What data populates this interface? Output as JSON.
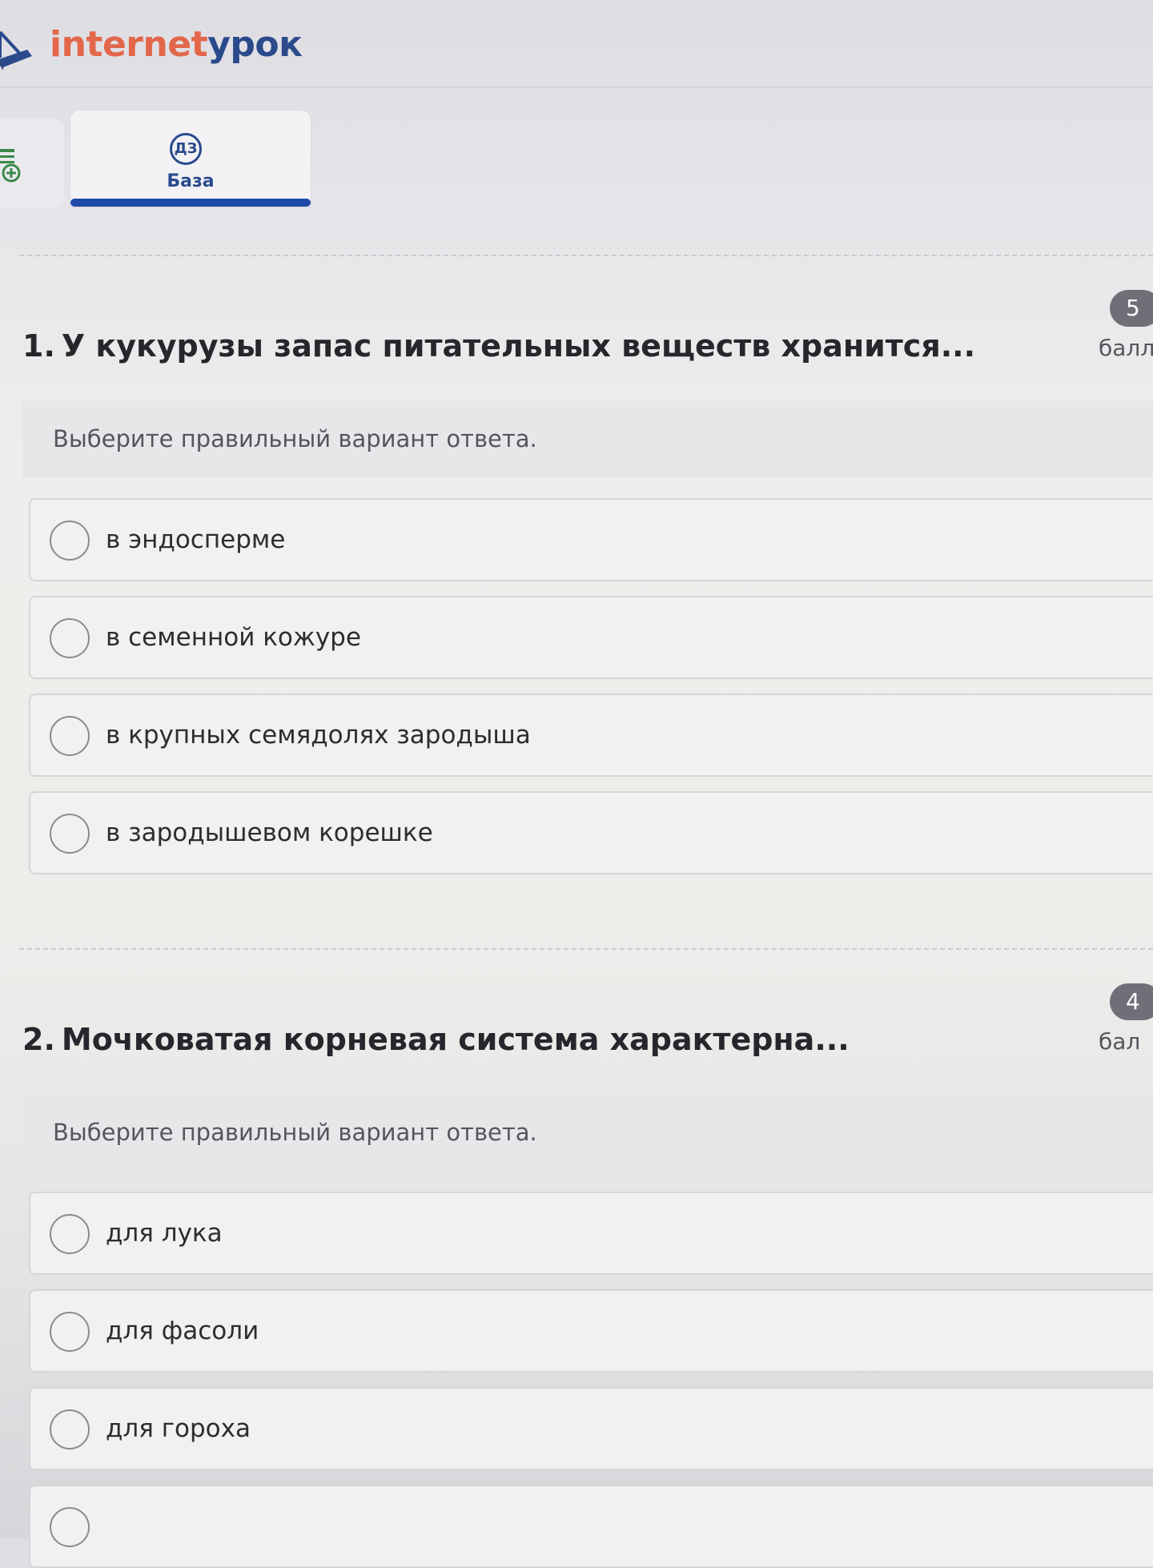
{
  "header": {
    "logo_part1": "internet",
    "logo_part2": "урок"
  },
  "tabs": {
    "active_badge": "ДЗ",
    "active_label": "База"
  },
  "questions": [
    {
      "number": "1.",
      "title": "У кукурузы запас питательных веществ хранится...",
      "points": "5",
      "points_label": "балл",
      "instruction": "Выберите правильный вариант ответа.",
      "options": [
        "в эндосперме",
        "в семенной кожуре",
        "в крупных семядолях зародыша",
        "в зародышевом корешке"
      ]
    },
    {
      "number": "2.",
      "title": "Мочковатая корневая система характерна...",
      "points": "4",
      "points_label": "бал",
      "instruction": "Выберите правильный вариант ответа.",
      "options": [
        "для лука",
        "для фасоли",
        "для гороха"
      ]
    }
  ],
  "colors": {
    "brand_orange": "#e2674a",
    "brand_blue": "#2b4a8c",
    "tab_underline": "#1f4aa8"
  }
}
